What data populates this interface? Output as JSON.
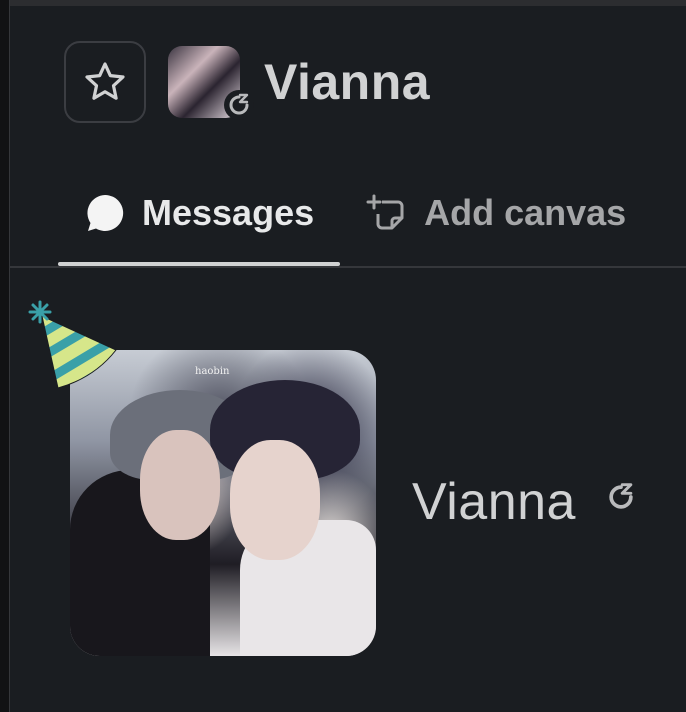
{
  "header": {
    "title": "Vianna",
    "star_icon": "star-icon",
    "status_icon": "dnd-snooze-icon"
  },
  "tabs": [
    {
      "label": "Messages",
      "icon": "message-bubble-icon",
      "active": true
    },
    {
      "label": "Add canvas",
      "icon": "canvas-add-icon",
      "active": false
    }
  ],
  "profile": {
    "name": "Vianna",
    "status_icon": "dnd-snooze-icon",
    "decoration": "party-hat-icon",
    "watermark": "haobin"
  },
  "colors": {
    "background": "#1a1d21",
    "text_primary": "#d1d2d3",
    "text_secondary": "#a5a6a8",
    "hat_yellow": "#d6e68a",
    "hat_teal": "#3aa0a8"
  }
}
